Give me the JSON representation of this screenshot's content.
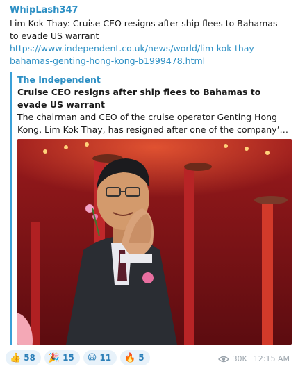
{
  "message": {
    "sender": "WhipLash347",
    "text": "Lim Kok Thay: Cruise CEO resigns after ship flees to Bahamas to evade US warrant",
    "link": "https://www.independent.co.uk/news/world/lim-kok-thay-bahamas-genting-hong-kong-b1999478.html"
  },
  "preview": {
    "site": "The Independent",
    "title": "Cruise CEO resigns after ship flees to Bahamas to evade US warrant",
    "description": "The chairman and CEO of the cruise operator Genting Hong Kong, Lim Kok Thay, has resigned after one of the company’s vessels w..."
  },
  "reactions": [
    {
      "emoji": "👍",
      "icon": "thumbs-up-icon",
      "count": "58"
    },
    {
      "emoji": "🎉",
      "icon": "party-popper-icon",
      "count": "15"
    },
    {
      "emoji": "😀",
      "icon": "grinning-face-icon",
      "count": "11"
    },
    {
      "emoji": "🔥",
      "icon": "fire-icon",
      "count": "5"
    }
  ],
  "meta": {
    "views": "30K",
    "time": "12:15 AM"
  },
  "colors": {
    "accent": "#2c8fc4",
    "preview_bar": "#3aa0d8",
    "reaction_bg": "#e8f2fa"
  }
}
